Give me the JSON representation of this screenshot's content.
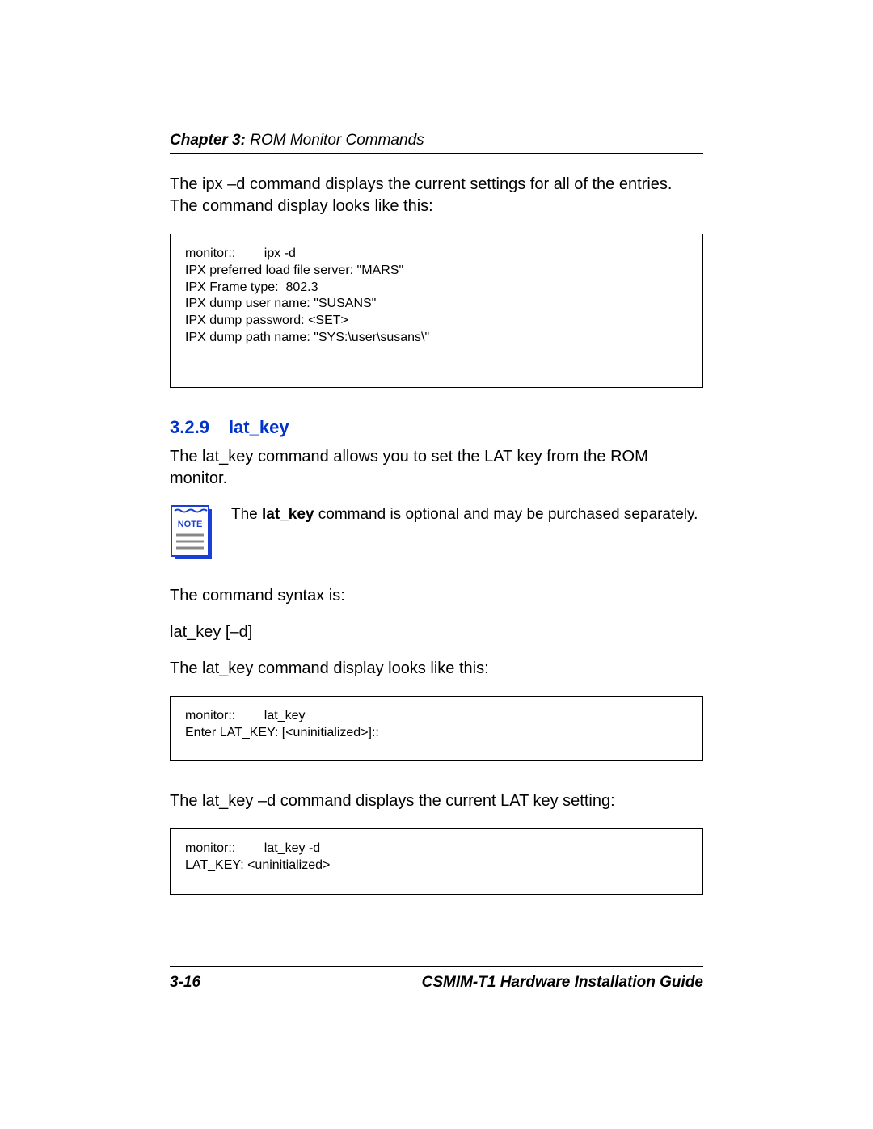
{
  "header": {
    "chapter_label": "Chapter 3: ",
    "chapter_title": "ROM Monitor Commands"
  },
  "intro_para": {
    "pre": "The ",
    "cmd": "ipx  –d ",
    "post": "command displays the current settings for all of the entries. The command display looks like this:"
  },
  "codebox1": "monitor::        ipx -d\nIPX preferred load file server: \"MARS\"\nIPX Frame type:  802.3\nIPX dump user name: \"SUSANS\"\nIPX dump password: <SET>\nIPX dump path name: \"SYS:\\user\\susans\\\"",
  "section": {
    "number": "3.2.9",
    "title": "lat_key"
  },
  "latkey_para": {
    "pre": "The ",
    "cmd": "lat_key",
    "post": " command allows you to set the LAT key from the ROM monitor."
  },
  "note": {
    "label": "NOTE",
    "pre": "The ",
    "bold": "lat_key",
    "post": " command is optional and may be purchased separately."
  },
  "syntax_intro": "The command syntax is:",
  "syntax_line": "lat_key [–d]",
  "latkey_display_intro": {
    "pre": "The ",
    "cmd": "lat_key",
    "post": " command display looks like this:"
  },
  "codebox2": "monitor::        lat_key\nEnter LAT_KEY: [<uninitialized>]::",
  "latkey_d_intro": {
    "pre": "The ",
    "cmd": "lat_key  –d ",
    "post": "command displays the current LAT key setting:"
  },
  "codebox3": "monitor::        lat_key -d\nLAT_KEY: <uninitialized>",
  "footer": {
    "page_num": "3-16",
    "guide": "CSMIM-T1 Hardware Installation Guide"
  }
}
